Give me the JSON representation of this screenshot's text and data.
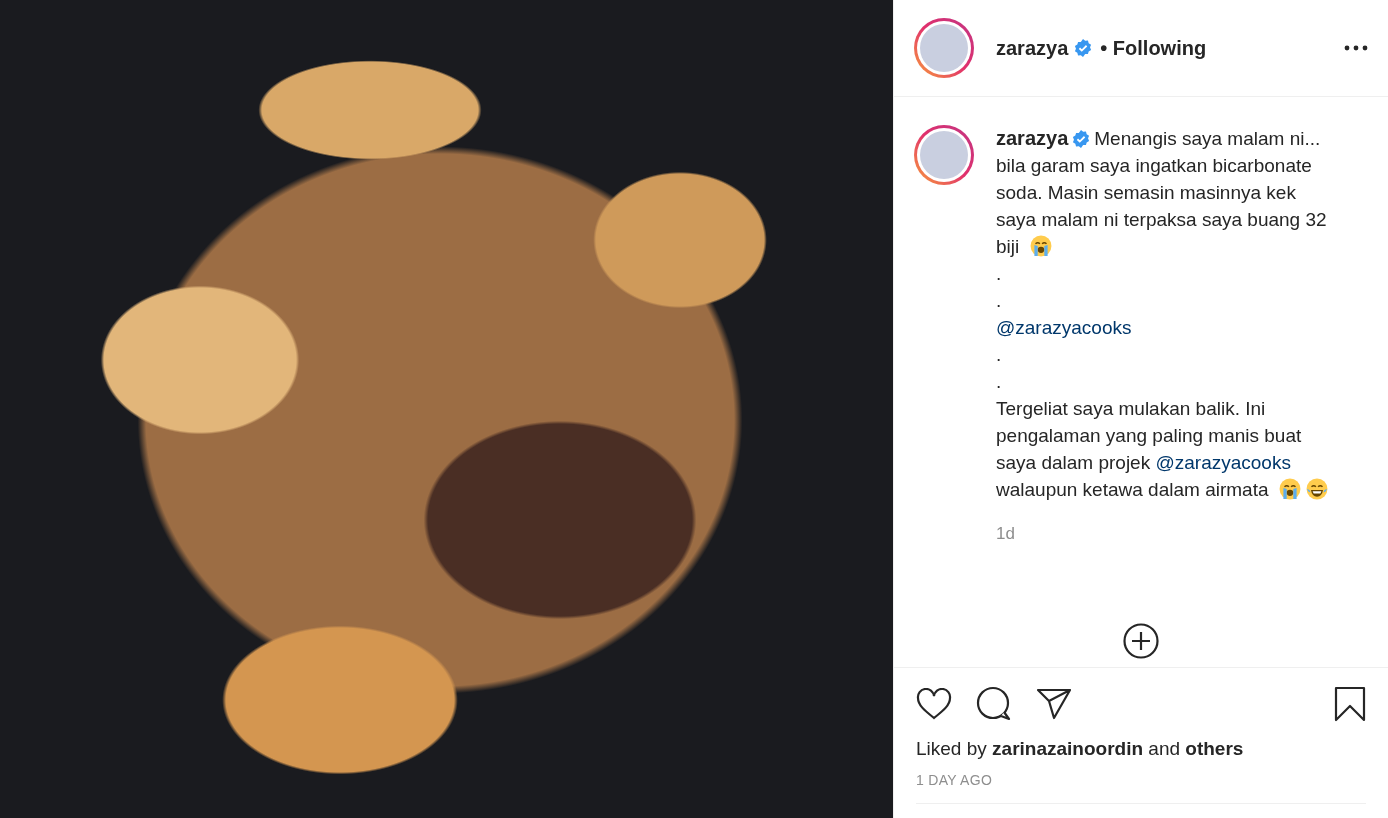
{
  "post": {
    "author": {
      "username": "zarazya",
      "verified": true,
      "separator": "•",
      "follow_status": "Following"
    },
    "caption": {
      "username": "zarazya",
      "verified": true,
      "blocks": [
        {
          "segments": [
            {
              "kind": "text",
              "text": "Menangis saya malam ni... bila garam saya ingatkan bicarbonate soda. Masin semasin masinnya kek saya malam ni terpaksa saya buang 32 biji "
            },
            {
              "kind": "crying-emoji"
            }
          ]
        },
        {
          "segments": [
            {
              "kind": "text",
              "text": "."
            }
          ]
        },
        {
          "segments": [
            {
              "kind": "text",
              "text": "."
            }
          ]
        },
        {
          "segments": [
            {
              "kind": "mention",
              "text": "@zarazyacooks"
            }
          ]
        },
        {
          "segments": [
            {
              "kind": "text",
              "text": "."
            }
          ]
        },
        {
          "segments": [
            {
              "kind": "text",
              "text": "."
            }
          ]
        },
        {
          "segments": [
            {
              "kind": "text",
              "text": "Tergeliat saya mulakan balik. Ini pengalaman yang paling manis buat saya dalam projek "
            },
            {
              "kind": "mention",
              "text": "@zarazyacooks"
            },
            {
              "kind": "text",
              "text": " walaupun ketawa dalam airmata "
            },
            {
              "kind": "crying-emoji"
            },
            {
              "kind": "laughing-emoji"
            }
          ]
        }
      ],
      "time": "1d"
    },
    "liked": false,
    "saved": false,
    "likes": {
      "prefix": "Liked by",
      "user": "zarinazainoordin",
      "joiner": "and",
      "others": "others"
    },
    "date": "1 DAY AGO"
  }
}
